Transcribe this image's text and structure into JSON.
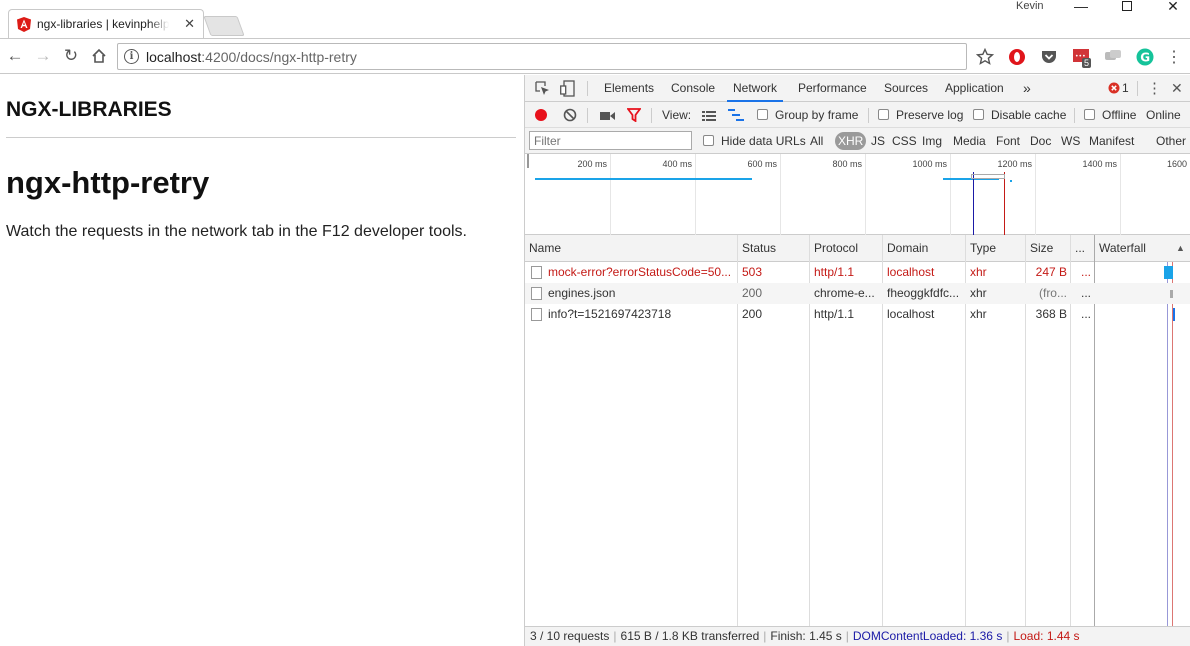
{
  "browser": {
    "tab_title": "ngx-libraries | kevinphelps",
    "profile_name": "Kevin",
    "url_host": "localhost",
    "url_rest": ":4200/docs/ngx-http-retry",
    "extension_badge": "5"
  },
  "page": {
    "brand": "NGX-LIBRARIES",
    "title": "ngx-http-retry",
    "description": "Watch the requests in the network tab in the F12 developer tools."
  },
  "devtools": {
    "tabs": [
      "Elements",
      "Console",
      "Network",
      "Performance",
      "Sources",
      "Application"
    ],
    "active_tab": "Network",
    "more_tabs": "»",
    "error_count": "1",
    "toolbar": {
      "view_label": "View:",
      "group_by_frame": "Group by frame",
      "preserve_log": "Preserve log",
      "disable_cache": "Disable cache",
      "offline": "Offline",
      "online": "Online"
    },
    "filter": {
      "placeholder": "Filter",
      "hide_data_urls": "Hide data URLs",
      "types": [
        "All",
        "XHR",
        "JS",
        "CSS",
        "Img",
        "Media",
        "Font",
        "Doc",
        "WS",
        "Manifest",
        "Other"
      ],
      "active_type": "XHR"
    },
    "overview_ticks": [
      "200 ms",
      "400 ms",
      "600 ms",
      "800 ms",
      "1000 ms",
      "1200 ms",
      "1400 ms",
      "1600"
    ],
    "columns": [
      "Name",
      "Status",
      "Protocol",
      "Domain",
      "Type",
      "Size",
      "...",
      "Waterfall"
    ],
    "requests": [
      {
        "name": "mock-error?errorStatusCode=50...",
        "status": "503",
        "protocol": "http/1.1",
        "domain": "localhost",
        "type": "xhr",
        "size": "247 B",
        "extra": "...",
        "error": true
      },
      {
        "name": "engines.json",
        "status": "200",
        "protocol": "chrome-e...",
        "domain": "fheoggkfdfc...",
        "type": "xhr",
        "size": "(fro...",
        "extra": "...",
        "error": false
      },
      {
        "name": "info?t=1521697423718",
        "status": "200",
        "protocol": "http/1.1",
        "domain": "localhost",
        "type": "xhr",
        "size": "368 B",
        "extra": "...",
        "error": false
      }
    ],
    "status": {
      "requests": "3 / 10 requests",
      "transferred": "615 B / 1.8 KB transferred",
      "finish": "Finish: 1.45 s",
      "dom_content_loaded": "DOMContentLoaded: 1.36 s",
      "load": "Load: 1.44 s"
    },
    "colors": {
      "dom_content_loaded": "#1a1aa6",
      "load": "#c41a16",
      "error": "#c41a16",
      "bar": "#1aa3e8"
    }
  }
}
